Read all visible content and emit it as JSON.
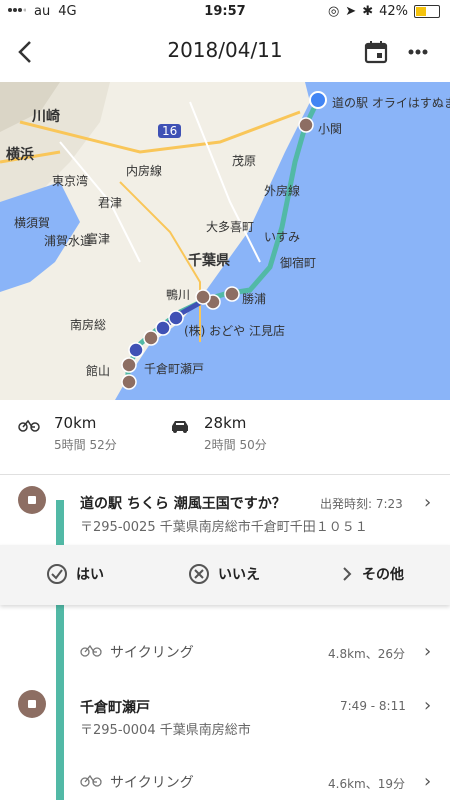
{
  "statusbar": {
    "carrier": "au",
    "network": "4G",
    "time": "19:57",
    "battery": "42%"
  },
  "appbar": {
    "title": "2018/04/11"
  },
  "map": {
    "labels": [
      "川崎",
      "横浜",
      "横須賀",
      "君津",
      "富津",
      "千葉県",
      "茂原",
      "大多喜町",
      "いすみ",
      "御宿町",
      "鴨川",
      "勝浦",
      "南房総",
      "館山",
      "内房線",
      "外房線",
      "東京湾",
      "浦賀水道",
      "小関",
      "(株) おどや 江見店",
      "千倉町瀬戸",
      "道の駅 オライはすぬま",
      "16"
    ]
  },
  "stats": {
    "bike": {
      "distance": "70km",
      "duration": "5時間 52分"
    },
    "car": {
      "distance": "28km",
      "duration": "2時間 50分"
    }
  },
  "timeline": {
    "stop1": {
      "title": "道の駅 ちくら 潮風王国ですか？",
      "time": "出発時刻: 7:23",
      "address": "〒295-0025 千葉県南房総市千倉町千田１０５１"
    },
    "actions": {
      "yes": "はい",
      "no": "いいえ",
      "other": "その他"
    },
    "seg1": {
      "label": "サイクリング",
      "info": "4.8km、26分"
    },
    "stop2": {
      "title": "千倉町瀬戸",
      "time": "7:49 - 8:11",
      "address": "〒295-0004 千葉県南房総市"
    },
    "seg2": {
      "label": "サイクリング",
      "info": "4.6km、19分"
    }
  },
  "colors": {
    "route": "#52b9a6",
    "stop": "#8d6e63",
    "water": "#8ab4f8",
    "land": "#f2efe6"
  }
}
